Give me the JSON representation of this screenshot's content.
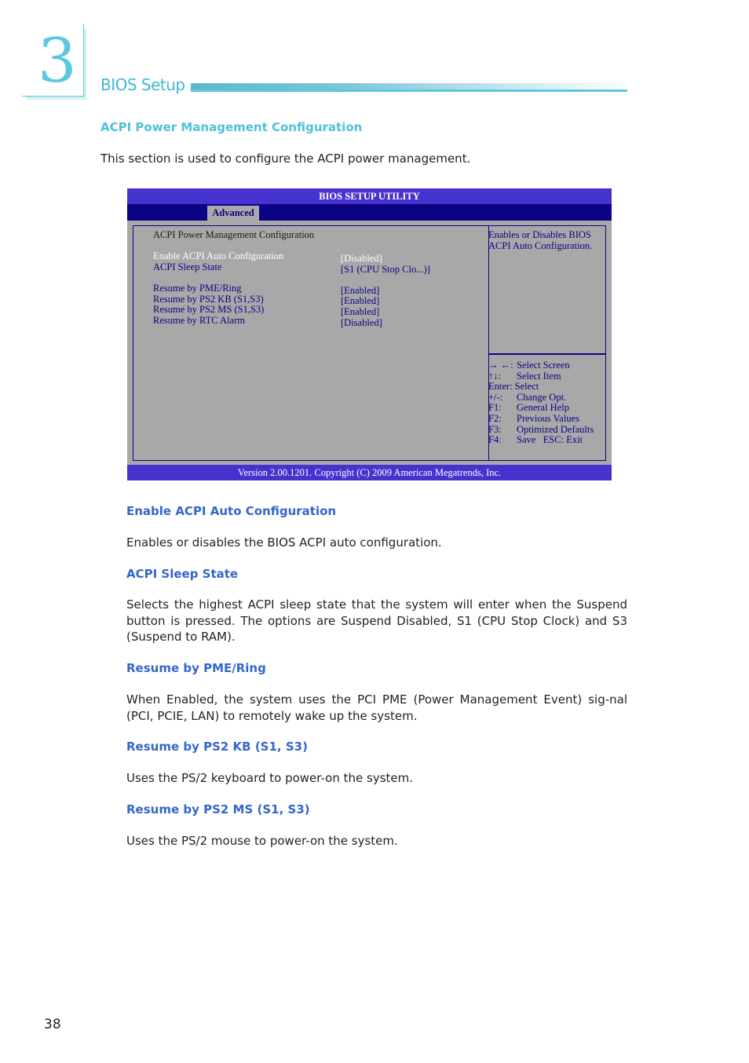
{
  "chapter": {
    "number": "3",
    "title": "BIOS Setup",
    "accent_color": "#5bc8de"
  },
  "section": {
    "heading": "ACPI Power Management Configuration",
    "intro": "This section is used to configure the ACPI power management."
  },
  "bios": {
    "title": "BIOS SETUP UTILITY",
    "active_tab": "Advanced",
    "screen_heading": "ACPI Power Management Configuration",
    "items": [
      {
        "label": "Enable ACPI Auto Configuration",
        "value": "[Disabled]",
        "selected": true
      },
      {
        "label": "ACPI Sleep State",
        "value": "[S1 (CPU Stop Clo...)]",
        "selected": false
      },
      {
        "label": "Resume by PME/Ring",
        "value": "[Enabled]",
        "selected": false
      },
      {
        "label": "Resume by PS2 KB (S1,S3)",
        "value": "[Enabled]",
        "selected": false
      },
      {
        "label": "Resume by PS2 MS (S1,S3)",
        "value": "[Enabled]",
        "selected": false
      },
      {
        "label": "Resume by RTC Alarm",
        "value": "[Disabled]",
        "selected": false
      }
    ],
    "help_text": [
      "Enables or Disables BIOS",
      "ACPI Auto Configuration."
    ],
    "keys": [
      {
        "key": "→ ←:",
        "action": "Select Screen"
      },
      {
        "key": "↑↓:",
        "action": "Select Item"
      },
      {
        "key": "Enter:",
        "action": "Select"
      },
      {
        "key": "+/-:",
        "action": "Change Opt."
      },
      {
        "key": "F1:",
        "action": "General Help"
      },
      {
        "key": "F2:",
        "action": "Previous Values"
      },
      {
        "key": "F3:",
        "action": "Optimized Defaults"
      },
      {
        "key": "F4:",
        "action": "Save   ESC: Exit"
      }
    ],
    "footer": "Version 2.00.1201. Copyright (C) 2009 American Megatrends, Inc.",
    "colors": {
      "title_bar": "#4633cf",
      "menu_bar": "#0b0284",
      "panel": "#a8a8a8"
    }
  },
  "descriptions": [
    {
      "heading": "Enable ACPI Auto Configuration",
      "text": "Enables or disables the BIOS ACPI auto configuration."
    },
    {
      "heading": "ACPI Sleep State",
      "text": "Selects the highest ACPI sleep state that the system will enter when the Suspend button is pressed. The options are Suspend Disabled, S1 (CPU Stop Clock) and S3 (Suspend to RAM)."
    },
    {
      "heading": "Resume by PME/Ring",
      "text": "When Enabled, the system uses the PCI PME (Power Management Event) sig-nal (PCI, PCIE, LAN) to remotely wake up the system."
    },
    {
      "heading": "Resume by PS2 KB (S1, S3)",
      "text": "Uses the PS/2 keyboard to power-on the system."
    },
    {
      "heading": "Resume by PS2 MS (S1, S3)",
      "text": "Uses the PS/2 mouse to power-on the system."
    }
  ],
  "page_number": "38"
}
